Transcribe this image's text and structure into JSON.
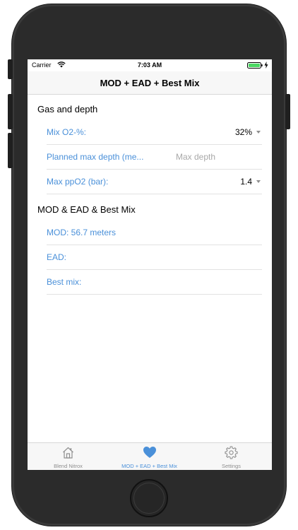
{
  "status_bar": {
    "carrier": "Carrier",
    "time": "7:03 AM"
  },
  "nav": {
    "title": "MOD + EAD + Best Mix"
  },
  "sections": {
    "gas": {
      "header": "Gas and depth",
      "mix_o2_label": "Mix O2-%:",
      "mix_o2_value": "32%",
      "max_depth_label": "Planned max depth (me...",
      "max_depth_value": "",
      "max_depth_placeholder": "Max depth",
      "ppo2_label": "Max ppO2 (bar):",
      "ppo2_value": "1.4"
    },
    "results": {
      "header": "MOD & EAD & Best Mix",
      "mod": "MOD: 56.7 meters",
      "ead": "EAD:",
      "best_mix": "Best mix:"
    }
  },
  "tabs": [
    {
      "label": "Blend Nitrox",
      "icon": "home-icon",
      "active": false
    },
    {
      "label": "MOD + EAD + Best Mix",
      "icon": "heart-icon",
      "active": true
    },
    {
      "label": "Settings",
      "icon": "gear-icon",
      "active": false
    }
  ],
  "colors": {
    "accent": "#4a90d9",
    "tab_inactive": "#8e8e8e",
    "battery": "#4cd964"
  }
}
